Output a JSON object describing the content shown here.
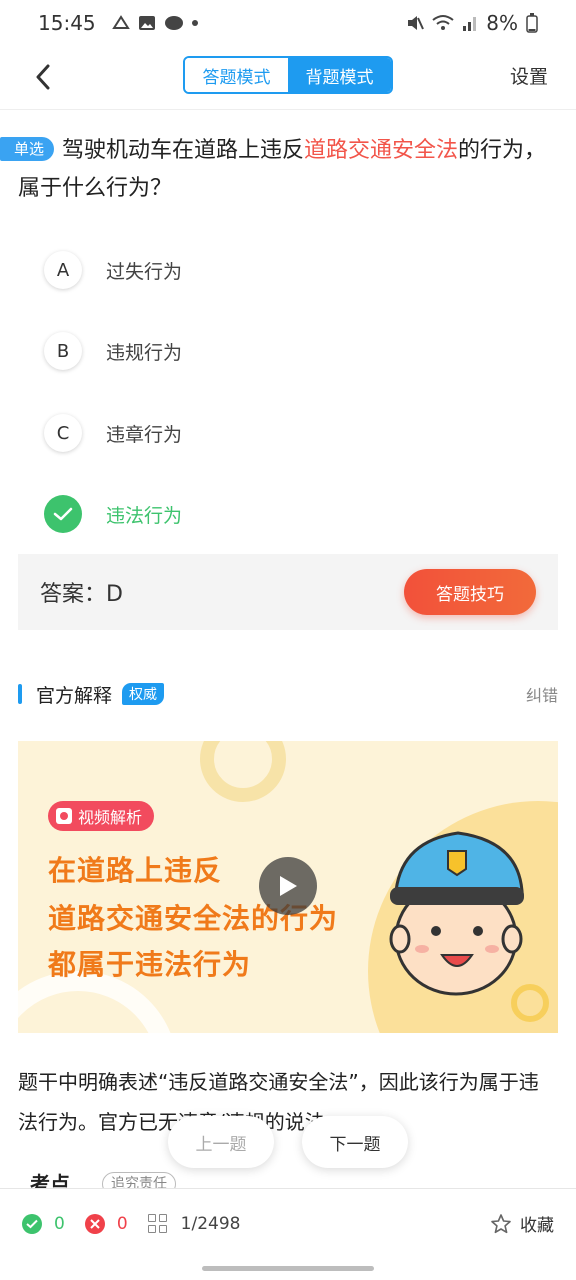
{
  "status_bar": {
    "time": "15:45",
    "battery": "8%"
  },
  "header": {
    "back_label": "",
    "tabs": [
      {
        "label": "答题模式",
        "active": false
      },
      {
        "label": "背题模式",
        "active": true
      }
    ],
    "settings_label": "设置"
  },
  "question": {
    "badge": "单选",
    "text_before": "驾驶机动车在道路上违反",
    "text_highlight": "道路交通安全法",
    "text_after": "的行为，属于什么行为？"
  },
  "options": [
    {
      "letter": "A",
      "text": "过失行为",
      "correct": false
    },
    {
      "letter": "B",
      "text": "违规行为",
      "correct": false
    },
    {
      "letter": "C",
      "text": "违章行为",
      "correct": false
    },
    {
      "letter": "D",
      "text": "违法行为",
      "correct": true
    }
  ],
  "answer": {
    "label": "答案：D",
    "tips_button": "答题技巧"
  },
  "explanation": {
    "title": "官方解释",
    "badge": "权威",
    "report": "纠错",
    "video": {
      "tag": "视频解析",
      "lines": [
        "在道路上违反",
        "道路交通安全法的行为",
        "都属于违法行为"
      ]
    },
    "text": "题干中明确表述“违反道路交通安全法”，因此该行为属于违法行为。官方已无违章/违规的说法。"
  },
  "kaodian": {
    "label": "考点",
    "tag": "追究责任"
  },
  "nav": {
    "prev": "上一题",
    "next": "下一题"
  },
  "bottom_bar": {
    "correct_count": "0",
    "wrong_count": "0",
    "progress": "1/2498",
    "favorite": "收藏"
  },
  "colors": {
    "accent": "#1e9bf0",
    "correct": "#3dc36d",
    "wrong": "#f0414a",
    "highlight": "#f2554a"
  }
}
